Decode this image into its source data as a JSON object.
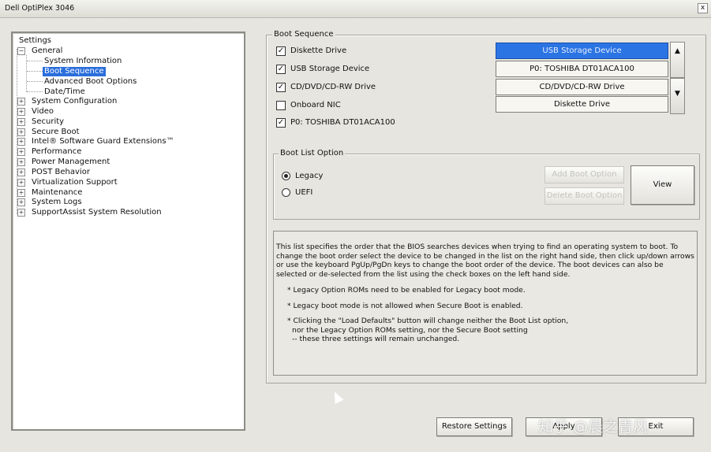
{
  "window": {
    "title": "Dell OptiPlex 3046",
    "close_glyph": "x"
  },
  "tree": {
    "root": "Settings",
    "general": "General",
    "general_children": [
      "System Information",
      "Boot Sequence",
      "Advanced Boot Options",
      "Date/Time"
    ],
    "selected": "Boot Sequence",
    "sections": [
      "System Configuration",
      "Video",
      "Security",
      "Secure Boot",
      "Intel® Software Guard Extensions™",
      "Performance",
      "Power Management",
      "POST Behavior",
      "Virtualization Support",
      "Maintenance",
      "System Logs",
      "SupportAssist System Resolution"
    ],
    "expand_glyph": "+",
    "collapse_glyph": "−"
  },
  "boot_sequence": {
    "title": "Boot Sequence",
    "devices": [
      {
        "label": "Diskette Drive",
        "checked": true
      },
      {
        "label": "USB Storage Device",
        "checked": true
      },
      {
        "label": "CD/DVD/CD-RW Drive",
        "checked": true
      },
      {
        "label": "Onboard NIC",
        "checked": false
      },
      {
        "label": "P0: TOSHIBA DT01ACA100",
        "checked": true
      }
    ],
    "order": [
      "USB Storage Device",
      "P0: TOSHIBA DT01ACA100",
      "CD/DVD/CD-RW Drive",
      "Diskette Drive"
    ],
    "selected_order_item": "USB Storage Device",
    "up_icon": "up-arrow-icon",
    "down_icon": "down-arrow-icon"
  },
  "boot_list_option": {
    "title": "Boot List Option",
    "options": [
      {
        "label": "Legacy",
        "selected": true
      },
      {
        "label": "UEFI",
        "selected": false
      }
    ],
    "add_button": "Add Boot Option",
    "delete_button": "Delete Boot Option",
    "view_button": "View"
  },
  "description": {
    "paragraph": "This list specifies the order that the BIOS searches devices when trying to find an operating system to boot. To change the boot order select the device to be changed in the list on the right hand side, then click up/down arrows or use the keyboard PgUp/PgDn keys to change the boot order of the device. The boot devices can also be selected or de-selected from the list using the check boxes on the left hand side.",
    "note1": "* Legacy Option ROMs need to be enabled for Legacy boot mode.",
    "note2": "* Legacy boot mode is not allowed when Secure Boot is enabled.",
    "note3_line1": "* Clicking the \"Load Defaults\" button will change neither the Boot List option,",
    "note3_line2": "nor the Legacy Option ROMs setting, nor the Secure Boot setting",
    "note3_line3": "-- these three settings will remain unchanged."
  },
  "footer": {
    "restore_button": "Restore Settings",
    "apply_button": "Apply",
    "exit_button": "Exit"
  },
  "watermark": "知乎 @晨之青风"
}
